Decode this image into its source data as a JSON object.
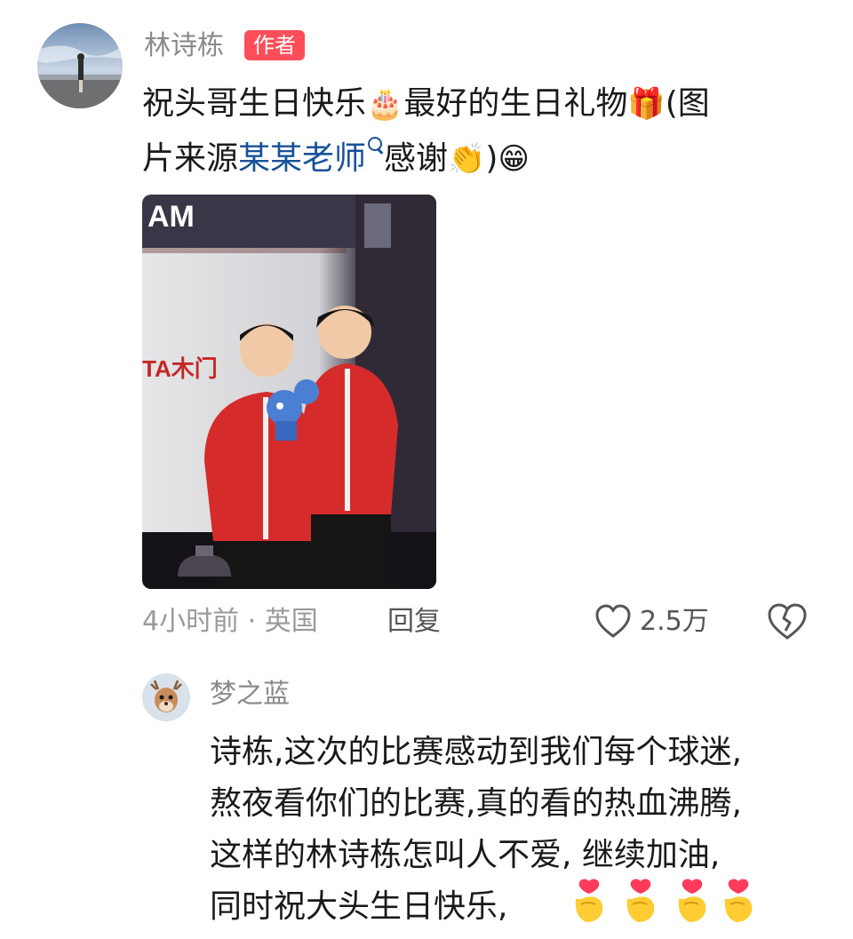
{
  "comment": {
    "author_name": "林诗栋",
    "author_badge": "作者",
    "text_part1": "祝头哥生日快乐",
    "text_part2": "最好的生日礼物",
    "text_part3": "(图",
    "text_part4": "片来源",
    "mention": "某某老师",
    "text_part5": "感谢",
    "text_part6": ")",
    "emoji_cake": "cake-icon",
    "emoji_gift": "gift-icon",
    "emoji_clap": "clapping-hands-icon",
    "emoji_grin": "grinning-face-icon",
    "time_location": "4小时前 · 英国",
    "reply_label": "回复",
    "like_count": "2.5万"
  },
  "photo": {
    "sign_text": "TA木门",
    "top_text": "AM"
  },
  "reply": {
    "author_name": "梦之蓝",
    "line1": "诗栋,这次的比赛感动到我们每个球迷,",
    "line2": "熬夜看你们的比赛,真的看的热血沸腾,",
    "line3": "这样的林诗栋怎叫人不爱, 继续加油,",
    "line4": "同时祝大头生日快乐,",
    "emoji": "heart-hands-icon"
  },
  "colors": {
    "badge": "#ff4d5a",
    "mention": "#175199",
    "secondary_text": "#8a8a8a"
  }
}
